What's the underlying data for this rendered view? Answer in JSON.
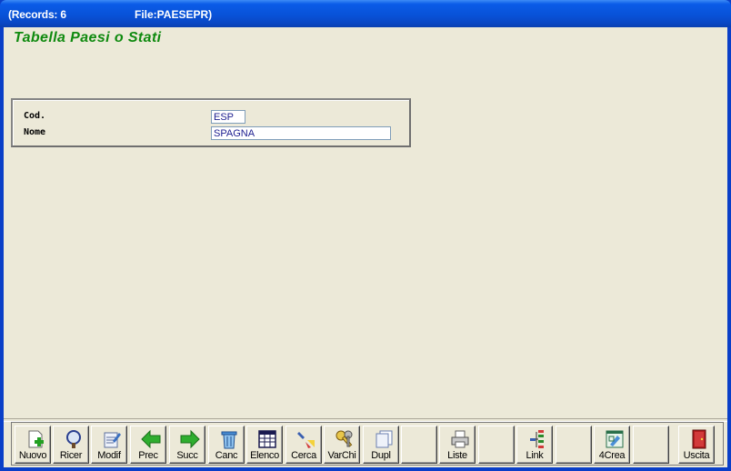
{
  "window": {
    "records_label": "(Records: 6",
    "file_label": "File:PAESEPR)"
  },
  "form": {
    "title": "Tabella Paesi o Stati",
    "fields": {
      "cod_label": "Cod.",
      "cod_value": "ESP",
      "nome_label": "Nome",
      "nome_value": "SPAGNA"
    }
  },
  "toolbar": {
    "buttons": [
      {
        "label": "Nuovo",
        "icon": "new-page-icon"
      },
      {
        "label": "Ricer",
        "icon": "search-magnifier-icon"
      },
      {
        "label": "Modif",
        "icon": "edit-document-icon"
      },
      {
        "label": "Prec",
        "icon": "arrow-left-icon"
      },
      {
        "label": "Succ",
        "icon": "arrow-right-icon"
      },
      {
        "label": "Canc",
        "icon": "trash-icon"
      },
      {
        "label": "Elenco",
        "icon": "table-icon"
      },
      {
        "label": "Cerca",
        "icon": "flashlight-icon"
      },
      {
        "label": "VarChi",
        "icon": "keys-icon"
      },
      {
        "label": "Dupl",
        "icon": "duplicate-icon"
      },
      {
        "label": "",
        "icon": ""
      },
      {
        "label": "Liste",
        "icon": "printer-icon"
      },
      {
        "label": "",
        "icon": ""
      },
      {
        "label": "Link",
        "icon": "tree-icon"
      },
      {
        "label": "",
        "icon": ""
      },
      {
        "label": "4Crea",
        "icon": "design-icon"
      },
      {
        "label": "",
        "icon": ""
      },
      {
        "label": "Uscita",
        "icon": "exit-door-icon"
      }
    ]
  },
  "colors": {
    "title_bar": "#0852d8",
    "form_title": "#0f8a0f",
    "field_text": "#1d1d8f",
    "background": "#ece9d8"
  }
}
